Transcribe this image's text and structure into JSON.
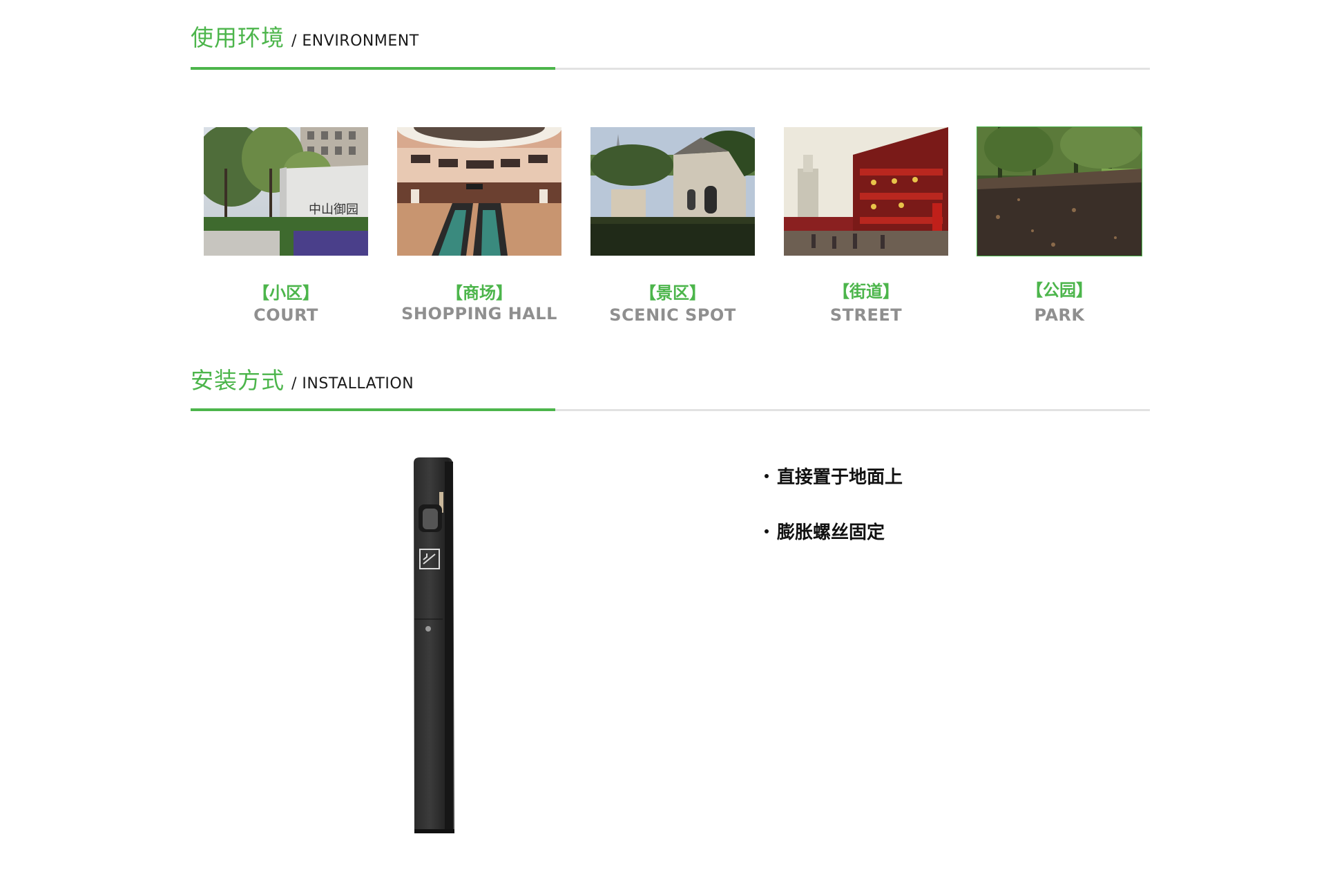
{
  "environment": {
    "title_cn": "使用环境",
    "title_en": "/ ENVIRONMENT",
    "items": [
      {
        "label_cn": "【小区】",
        "label_en": "COURT"
      },
      {
        "label_cn": "【商场】",
        "label_en": "SHOPPING HALL"
      },
      {
        "label_cn": "【景区】",
        "label_en": "SCENIC SPOT"
      },
      {
        "label_cn": "【街道】",
        "label_en": "STREET"
      },
      {
        "label_cn": "【公园】",
        "label_en": "PARK"
      }
    ]
  },
  "installation": {
    "title_cn": "安装方式",
    "title_en": "/ INSTALLATION",
    "features": [
      "直接置于地面上",
      "膨胀螺丝固定"
    ]
  },
  "colors": {
    "accent": "#4cb54b",
    "caption_gray": "#8f8f8f",
    "rule_gray": "#e2e2e2"
  }
}
